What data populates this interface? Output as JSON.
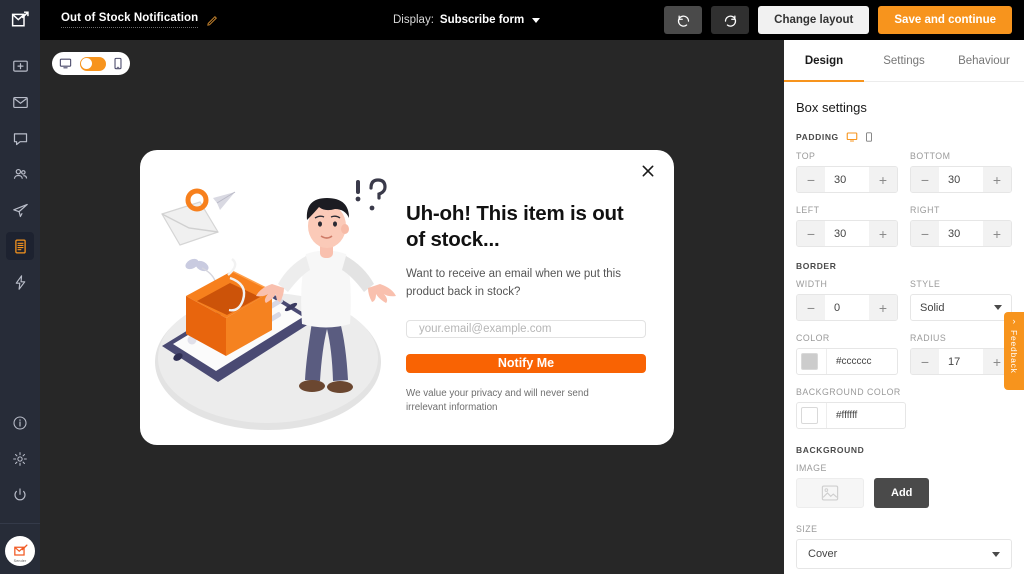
{
  "header": {
    "logo_icon": "sender-envelope-arrow-icon",
    "doc_title": "Out of Stock Notification",
    "edit_icon": "pencil-icon",
    "display_label": "Display:",
    "display_value": "Subscribe form",
    "undo_icon": "undo-icon",
    "redo_icon": "redo-icon",
    "change_layout_label": "Change layout",
    "save_label": "Save and continue"
  },
  "rail": {
    "items": [
      {
        "icon": "dashboard-icon",
        "name": "dashboard",
        "active": false
      },
      {
        "icon": "email-icon",
        "name": "campaigns",
        "active": false
      },
      {
        "icon": "chat-icon",
        "name": "messages",
        "active": false
      },
      {
        "icon": "audience-icon",
        "name": "subscribers",
        "active": false
      },
      {
        "icon": "paper-plane-icon",
        "name": "automation",
        "active": false
      },
      {
        "icon": "forms-icon",
        "name": "forms",
        "active": true
      },
      {
        "icon": "lightning-icon",
        "name": "integrations",
        "active": false
      }
    ],
    "bottom_items": [
      {
        "icon": "info-icon",
        "name": "help"
      },
      {
        "icon": "gear-icon",
        "name": "settings"
      },
      {
        "icon": "power-icon",
        "name": "logout"
      }
    ],
    "account_badge": "Sender"
  },
  "canvas": {
    "device_toggle": {
      "desktop_icon": "desktop-monitor-icon",
      "mobile_icon": "mobile-phone-icon",
      "state": "desktop"
    }
  },
  "modal": {
    "close_icon": "close-x-icon",
    "heading": "Uh-oh! This item is out of stock...",
    "subtext": "Want to receive an email when we put this product back in stock?",
    "email_placeholder": "your.email@example.com",
    "email_value": "",
    "submit_label": "Notify Me",
    "privacy_note": "We value your privacy and will never send irrelevant information",
    "illustration": "out-of-stock-shrugging-man-illustration",
    "accent_color": "#f96303",
    "radius": "17"
  },
  "panel": {
    "tabs": [
      {
        "label": "Design",
        "active": true
      },
      {
        "label": "Settings",
        "active": false
      },
      {
        "label": "Behaviour",
        "active": false
      }
    ],
    "title": "Box settings",
    "padding": {
      "group_label": "PADDING",
      "desktop_icon": "desktop-monitor-icon",
      "mobile_icon": "mobile-phone-icon",
      "top": {
        "label": "TOP",
        "value": "30"
      },
      "bottom": {
        "label": "BOTTOM",
        "value": "30"
      },
      "left": {
        "label": "LEFT",
        "value": "30"
      },
      "right": {
        "label": "RIGHT",
        "value": "30"
      }
    },
    "border": {
      "group_label": "BORDER",
      "width": {
        "label": "WIDTH",
        "value": "0"
      },
      "style": {
        "label": "STYLE",
        "value": "Solid"
      },
      "color": {
        "label": "COLOR",
        "value": "#cccccc",
        "swatch": "#cccccc"
      },
      "radius": {
        "label": "RADIUS",
        "value": "17"
      }
    },
    "background_color": {
      "label": "BACKGROUND COLOR",
      "value": "#ffffff",
      "swatch": "#ffffff"
    },
    "background": {
      "group_label": "BACKGROUND",
      "image_label": "IMAGE",
      "image_placeholder_icon": "image-placeholder-icon",
      "add_label": "Add",
      "size_label": "SIZE",
      "size_value": "Cover"
    },
    "minus_glyph": "−",
    "plus_glyph": "+"
  },
  "feedback": {
    "label": "Feedback",
    "chevron": "›"
  }
}
